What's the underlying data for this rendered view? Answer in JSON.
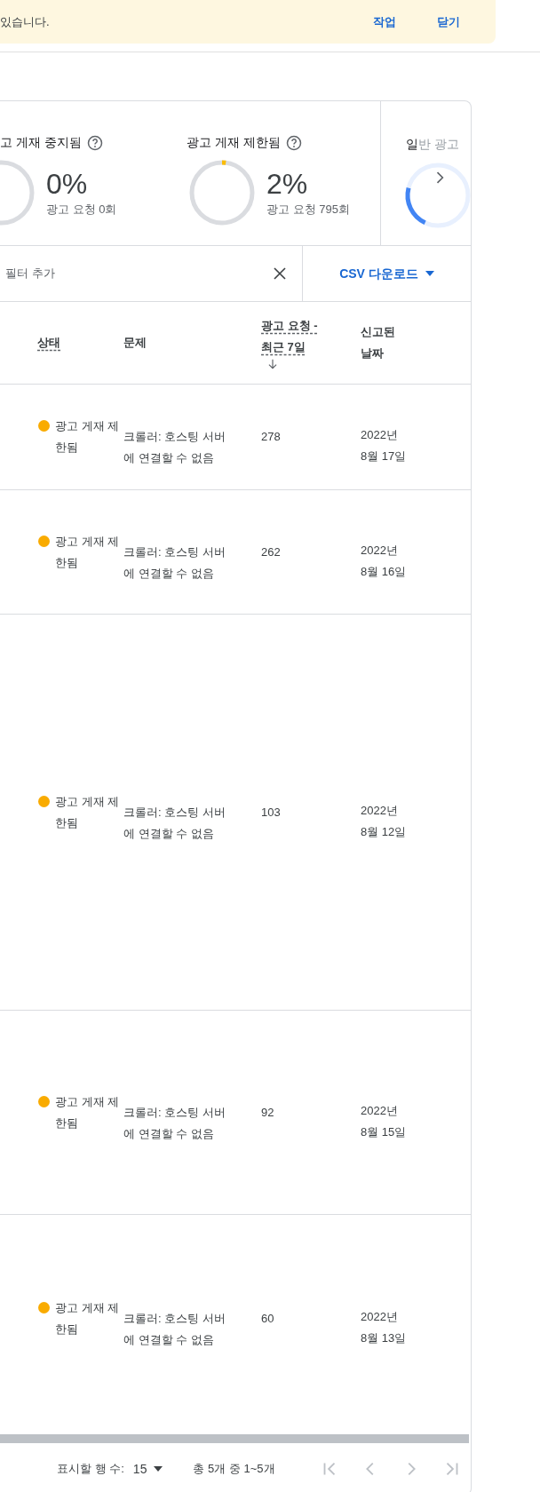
{
  "banner": {
    "message": "있습니다.",
    "actions": [
      "작업",
      "닫기"
    ]
  },
  "summary": {
    "stats": [
      {
        "title": "고 게재 중지됨",
        "value": "0%",
        "caption": "광고 요청 0회",
        "level": 0
      },
      {
        "title": "광고 게재 제한됨",
        "value": "2%",
        "caption": "광고 요청 795회",
        "level": 0.02,
        "color": "#fbbc04"
      }
    ],
    "next_panel": {
      "title_visible": "일",
      "title_faded": "반 광고",
      "level": 0.22,
      "color": "#4285f4"
    }
  },
  "toolbar": {
    "filter_placeholder": "필터 추가",
    "csv_button": "CSV 다운로드"
  },
  "table": {
    "columns": [
      {
        "label": "상태",
        "underlined": true,
        "sorted": false
      },
      {
        "label": "문제",
        "underlined": false,
        "sorted": false
      },
      {
        "label": "광고 요청 - 최근 7일",
        "underlined": true,
        "sorted": true
      },
      {
        "label": "신고된 날짜",
        "underlined": false,
        "sorted": false
      }
    ],
    "rows": [
      {
        "status": "광고 게재 제한됨",
        "color": "#f9ab00",
        "issue": "크롤러: 호스팅 서버에 연결할 수 없음",
        "requests": "278",
        "date": "2022년 8월 17일"
      },
      {
        "status": "광고 게재 제한됨",
        "color": "#f9ab00",
        "issue": "크롤러: 호스팅 서버에 연결할 수 없음",
        "requests": "262",
        "date": "2022년 8월 16일"
      },
      {
        "status": "광고 게재 제한됨",
        "color": "#f9ab00",
        "issue": "크롤러: 호스팅 서버에 연결할 수 없음",
        "requests": "103",
        "date": "2022년 8월 12일"
      },
      {
        "status": "광고 게재 제한됨",
        "color": "#f9ab00",
        "issue": "크롤러: 호스팅 서버에 연결할 수 없음",
        "requests": "92",
        "date": "2022년 8월 15일"
      },
      {
        "status": "광고 게재 제한됨",
        "color": "#f9ab00",
        "issue": "크롤러: 호스팅 서버에 연결할 수 없음",
        "requests": "60",
        "date": "2022년 8월 13일"
      }
    ]
  },
  "pagination": {
    "rows_label": "표시할 행 수:",
    "rows_value": "15",
    "range": "총 5개 중 1~5개"
  }
}
